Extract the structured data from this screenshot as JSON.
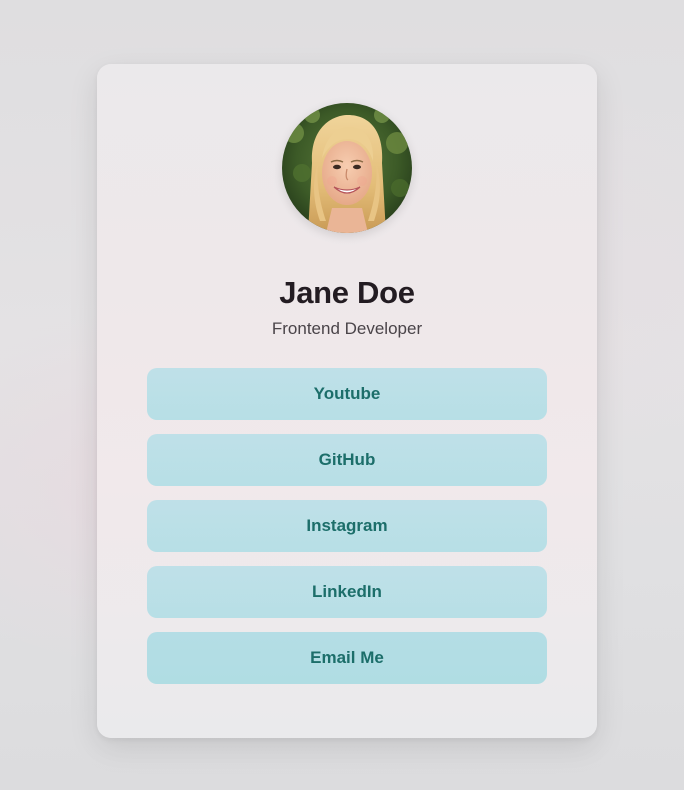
{
  "profile": {
    "name": "Jane Doe",
    "title": "Frontend Developer",
    "avatar": "profile-photo"
  },
  "links": [
    {
      "label": "Youtube"
    },
    {
      "label": "GitHub"
    },
    {
      "label": "Instagram"
    },
    {
      "label": "LinkedIn"
    },
    {
      "label": "Email Me"
    }
  ],
  "colors": {
    "button_bg": "#bfe0e8",
    "button_text": "#1c6e6a",
    "name_text": "#231c22",
    "card_bg": "#ece9eb"
  }
}
